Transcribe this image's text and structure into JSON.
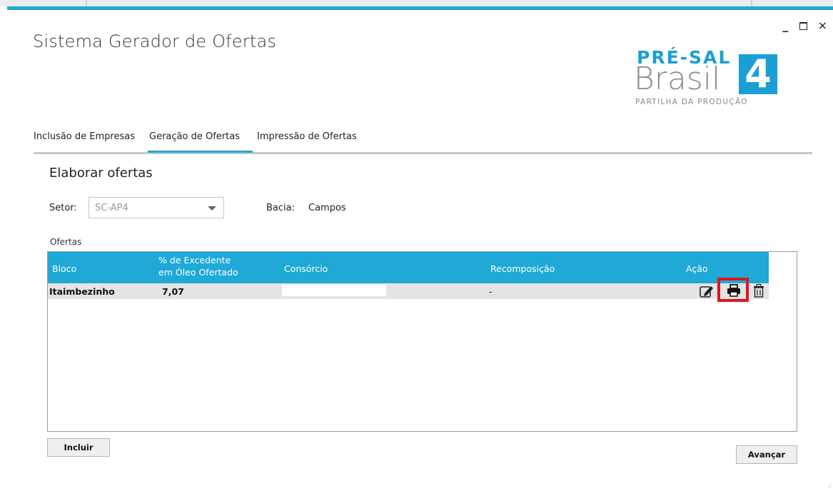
{
  "window": {
    "title": "Sistema Gerador de Ofertas",
    "controls": {
      "minimize": "_",
      "maximize": "",
      "close": "×"
    }
  },
  "logo": {
    "line1": "PRÉ-SAL",
    "line2": "Brasil",
    "number": "4",
    "tagline": "PARTILHA DA PRODUÇÃO"
  },
  "tabs": [
    {
      "label": "Inclusão de Empresas"
    },
    {
      "label": "Geração de Ofertas",
      "active": true
    },
    {
      "label": "Impressão de Ofertas"
    }
  ],
  "section": {
    "title": "Elaborar ofertas"
  },
  "filters": {
    "setor_label": "Setor:",
    "setor_value": "SC-AP4",
    "bacia_label": "Bacia:",
    "bacia_value": "Campos"
  },
  "ofertas": {
    "label": "Ofertas",
    "columns": {
      "bloco": "Bloco",
      "excedente_1": "% de Excedente",
      "excedente_2": "em Óleo Ofertado",
      "consorcio": "Consórcio",
      "recomposicao": "Recomposição",
      "acao": "Ação"
    },
    "rows": [
      {
        "bloco": "Itaimbezinho",
        "excedente": "7,07",
        "consorcio": "",
        "recomposicao": "-"
      }
    ]
  },
  "buttons": {
    "incluir": "Incluir",
    "avancar": "Avançar"
  },
  "colors": {
    "accent": "#1fa9d6",
    "highlight": "#e0141e",
    "row_bg": "#e4e4e4"
  },
  "icons": {
    "edit": "edit-icon",
    "print": "print-icon",
    "delete": "trash-icon"
  }
}
